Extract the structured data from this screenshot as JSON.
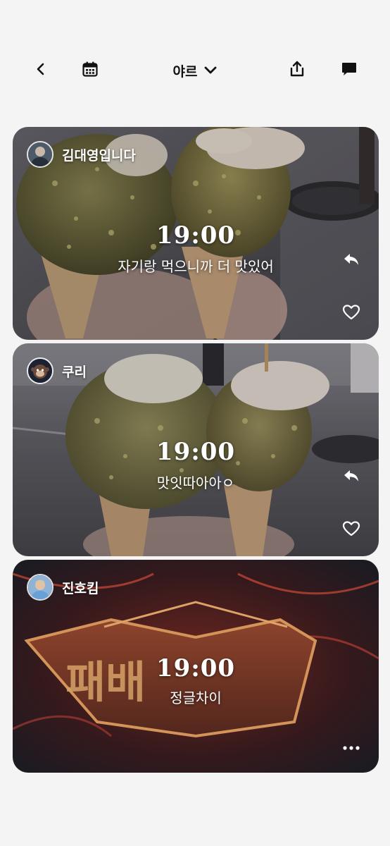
{
  "header": {
    "title": "야르",
    "back_icon": "chevron-left-icon",
    "calendar_icon": "calendar-icon",
    "dropdown_icon": "chevron-down-icon",
    "share_icon": "share-icon",
    "chat_icon": "chat-bubble-icon"
  },
  "posts": [
    {
      "author": "김대영입니다",
      "time": "19:00",
      "caption": "자기랑 먹으니까 더 맛있어",
      "actions": [
        "reply-icon",
        "heart-icon"
      ]
    },
    {
      "author": "쿠리",
      "time": "19:00",
      "caption": "맛잇따아아ㅇ",
      "actions": [
        "reply-icon",
        "heart-icon"
      ]
    },
    {
      "author": "진호킴",
      "time": "19:00",
      "caption": "정글차이",
      "actions": [
        "more-icon"
      ]
    }
  ],
  "colors": {
    "background": "#f4f4f4",
    "text_dark": "#111111",
    "overlay_text": "#ffffff"
  }
}
